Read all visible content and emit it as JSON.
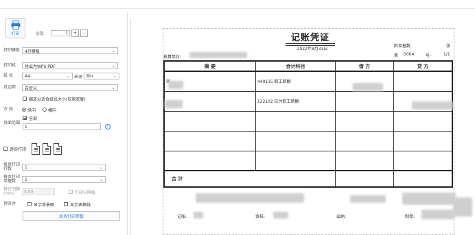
{
  "left_panel": {
    "print_label": "打印",
    "copies_label": "份数",
    "copies_value": "1",
    "plus": "+",
    "minus": "-",
    "template_label": "打印模板",
    "template_value": "4行模板",
    "printer_label": "打印机",
    "printer_value": "导出为WPS PDF",
    "paper_label": "纸 张",
    "paper_value": "A4",
    "source_label": "来源",
    "source_value": "Bin",
    "margin_label": "页边距",
    "margin_value": "自定义",
    "scale_label": "缩放以适合纸张大小(仅限宽度)",
    "direction_label": "方 向",
    "portrait_label": "纵向",
    "landscape_label": "横向",
    "page_range_label": "页面范围",
    "all_label": "全部",
    "range_value": "1",
    "collate_label": "逐份打印",
    "rows_per_page_label": "每页打印行数",
    "rows_per_page_value": "1",
    "vouchers_per_page_label": "每页打印单据数",
    "vouchers_per_page_value": "1",
    "spacing_label": "每行间隔(mm)",
    "spacing_value": "0.00",
    "print_divider_label": "打印分隔线",
    "preview_label": "预览时",
    "show_bg_label": "显示背景图",
    "show_grid_label": "显示表格线",
    "business_params_button": "业务打印参数"
  },
  "voucher": {
    "title": "记账凭证",
    "date": "2022年8月31日",
    "unit_label": "核算单位:",
    "attach_label": "附单据数",
    "attach_unit": "张",
    "number_prefix": "第",
    "number_value": "0004",
    "number_suffix": "号-",
    "page_fraction": "1/1",
    "col_summary": "摘 要",
    "col_account": "会计科目",
    "col_debit": "借 方",
    "col_credit": "贷 方",
    "row1_summary": "转",
    "row1_account": "440115 职工薪酬",
    "row2_account": "122102 应付职工薪酬",
    "total_label": "合 计",
    "bookkeeper_label": "记账:",
    "auditor_label": "审核:",
    "cashier_label": "出纳:",
    "maker_label": "制单:"
  }
}
